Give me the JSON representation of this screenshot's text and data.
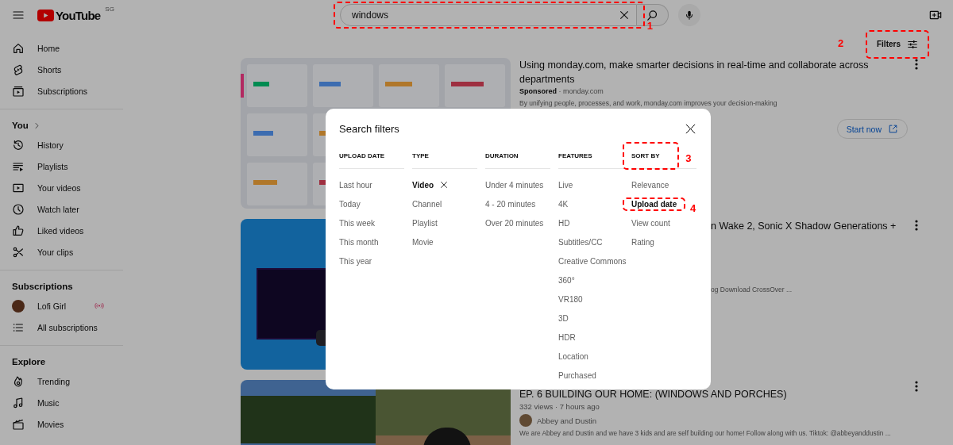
{
  "header": {
    "logo_text": "YouTube",
    "country_code": "SG",
    "search": {
      "value": "windows",
      "annotation": "1"
    }
  },
  "sidebar": [
    {
      "items": [
        {
          "kind": "home",
          "label": "Home"
        },
        {
          "kind": "shorts",
          "label": "Shorts"
        },
        {
          "kind": "subscriptions",
          "label": "Subscriptions"
        }
      ]
    },
    {
      "heading": "You",
      "heading_chevron": true,
      "items": [
        {
          "kind": "history",
          "label": "History"
        },
        {
          "kind": "playlists",
          "label": "Playlists"
        },
        {
          "kind": "videos",
          "label": "Your videos"
        },
        {
          "kind": "later",
          "label": "Watch later"
        },
        {
          "kind": "liked",
          "label": "Liked videos"
        },
        {
          "kind": "clips",
          "label": "Your clips"
        }
      ]
    },
    {
      "heading": "Subscriptions",
      "items": [
        {
          "kind": "channel",
          "label": "Lofi Girl",
          "live": true
        },
        {
          "kind": "list",
          "label": "All subscriptions",
          "live": false
        }
      ]
    },
    {
      "heading": "Explore",
      "items": [
        {
          "kind": "trending",
          "label": "Trending"
        },
        {
          "kind": "music",
          "label": "Music"
        },
        {
          "kind": "movies",
          "label": "Movies"
        }
      ]
    }
  ],
  "filters_button": {
    "label": "Filters",
    "annotation": "2"
  },
  "results": [
    {
      "kind": "ad",
      "title": "Using monday.com, make smarter decisions in real-time and collaborate across departments",
      "byline": "**Sponsored** · monday.com",
      "description": "By unifying people, processes, and work, monday.com improves your decision-making",
      "action_button": "Start now"
    },
    {
      "kind": "partial",
      "title": "n Wake 2, Sonic X Shadow Generations +",
      "description": "og Download CrossOver ..."
    },
    {
      "kind": "video",
      "title": "EP. 6 BUILDING OUR HOME: (WINDOWS AND PORCHES)",
      "meta": "332 views · 7 hours ago",
      "channel": "Abbey and Dustin",
      "description": "We are Abbey and Dustin and we have 3 kids and are self building our home! Follow along with us. Tiktok: @abbeyanddustin ..."
    }
  ],
  "dialog": {
    "title": "Search filters",
    "columns": [
      {
        "heading": "UPLOAD DATE",
        "options": [
          {
            "label": "Last hour",
            "selected": false
          },
          {
            "label": "Today",
            "selected": false
          },
          {
            "label": "This week",
            "selected": false
          },
          {
            "label": "This month",
            "selected": false
          },
          {
            "label": "This year",
            "selected": false
          }
        ]
      },
      {
        "heading": "TYPE",
        "options": [
          {
            "label": "Video",
            "selected": true
          },
          {
            "label": "Channel",
            "selected": false
          },
          {
            "label": "Playlist",
            "selected": false
          },
          {
            "label": "Movie",
            "selected": false
          }
        ]
      },
      {
        "heading": "DURATION",
        "options": [
          {
            "label": "Under 4 minutes",
            "selected": false
          },
          {
            "label": "4 - 20 minutes",
            "selected": false
          },
          {
            "label": "Over 20 minutes",
            "selected": false
          }
        ]
      },
      {
        "heading": "FEATURES",
        "options": [
          {
            "label": "Live",
            "selected": false
          },
          {
            "label": "4K",
            "selected": false
          },
          {
            "label": "HD",
            "selected": false
          },
          {
            "label": "Subtitles/CC",
            "selected": false
          },
          {
            "label": "Creative Commons",
            "selected": false
          },
          {
            "label": "360°",
            "selected": false
          },
          {
            "label": "VR180",
            "selected": false
          },
          {
            "label": "3D",
            "selected": false
          },
          {
            "label": "HDR",
            "selected": false
          },
          {
            "label": "Location",
            "selected": false
          },
          {
            "label": "Purchased",
            "selected": false
          }
        ]
      },
      {
        "heading": "SORT BY",
        "annotation": "3",
        "options": [
          {
            "label": "Relevance",
            "selected": false
          },
          {
            "label": "Upload date",
            "selected": true,
            "annotation": "4"
          },
          {
            "label": "View count",
            "selected": false
          },
          {
            "label": "Rating",
            "selected": false
          }
        ]
      }
    ]
  }
}
